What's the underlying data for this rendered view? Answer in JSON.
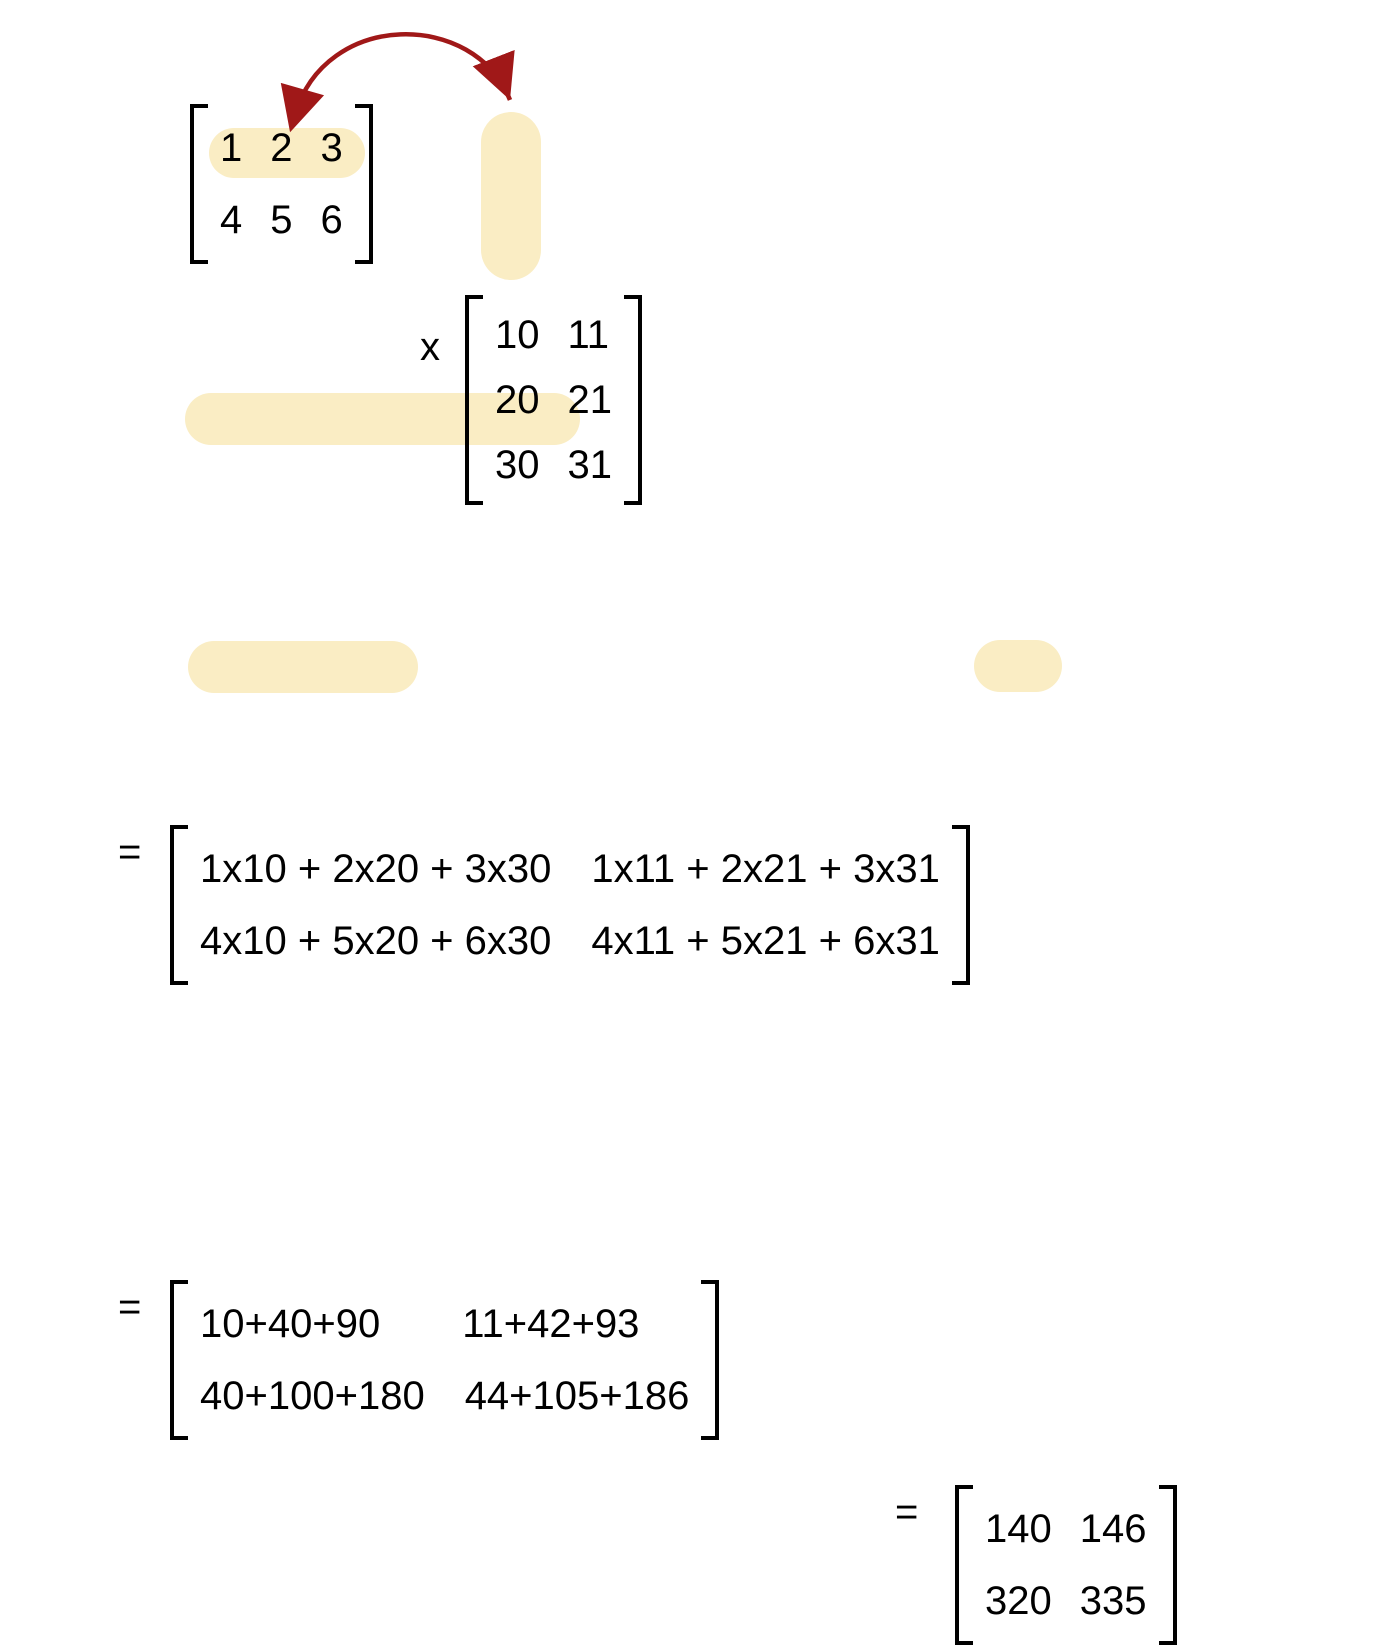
{
  "operator_times": "x",
  "operator_eq": "=",
  "colors": {
    "highlight": "#faedc4",
    "arrow": "#a01818"
  },
  "matrixA": {
    "rows": [
      {
        "c0": "1",
        "c1": "2",
        "c2": "3"
      },
      {
        "c0": "4",
        "c1": "5",
        "c2": "6"
      }
    ]
  },
  "matrixB": {
    "rows": [
      {
        "c0": "10",
        "c1": "11"
      },
      {
        "c0": "20",
        "c1": "21"
      },
      {
        "c0": "30",
        "c1": "31"
      }
    ]
  },
  "expansion1": {
    "rows": [
      {
        "c0": "1x10 + 2x20 + 3x30",
        "c1": "1x11 + 2x21 + 3x31"
      },
      {
        "c0": "4x10 + 5x20 + 6x30",
        "c1": "4x11 + 5x21 + 6x31"
      }
    ]
  },
  "expansion2": {
    "rows": [
      {
        "c0": "10+40+90",
        "c1": "11+42+93"
      },
      {
        "c0": "40+100+180",
        "c1": "44+105+186"
      }
    ]
  },
  "result": {
    "rows": [
      {
        "c0": "140",
        "c1": "146"
      },
      {
        "c0": "320",
        "c1": "335"
      }
    ]
  }
}
